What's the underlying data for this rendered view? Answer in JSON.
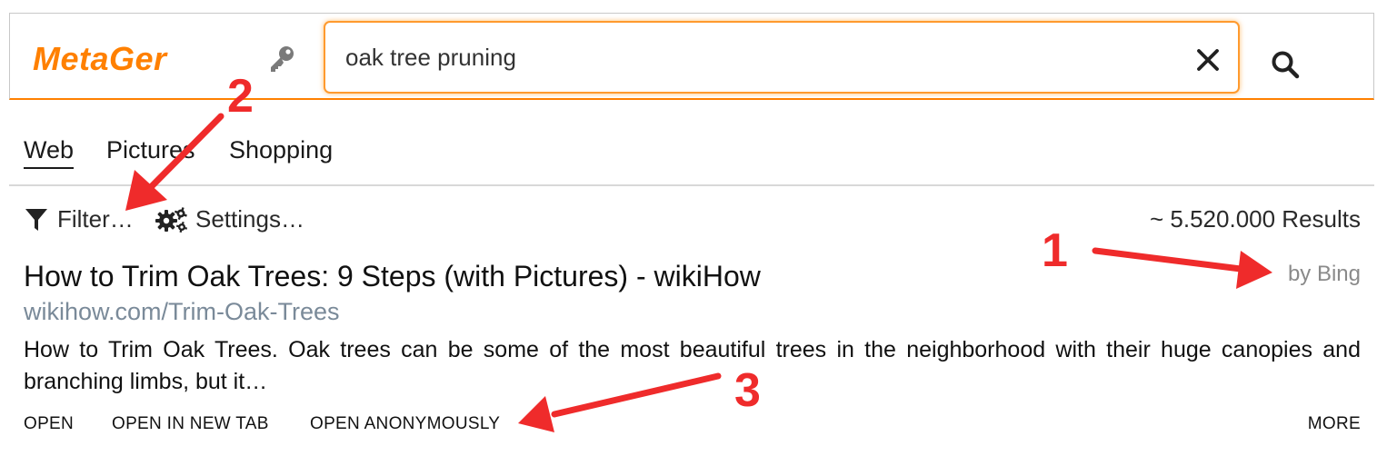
{
  "header": {
    "logo": "MetaGer",
    "search": {
      "value": "oak tree pruning",
      "placeholder": ""
    },
    "icons": {
      "key": "key-icon",
      "clear": "close-icon",
      "search": "search-icon"
    }
  },
  "tabs": [
    {
      "label": "Web",
      "active": true
    },
    {
      "label": "Pictures",
      "active": false
    },
    {
      "label": "Shopping",
      "active": false
    }
  ],
  "toolbar": {
    "filter_label": "Filter…",
    "settings_label": "Settings…",
    "results_count": "~ 5.520.000 Results"
  },
  "result": {
    "title": "How to Trim Oak Trees: 9 Steps (with Pictures) - wikiHow",
    "url": "wikihow.com/Trim-Oak-Trees",
    "description": "How to Trim Oak Trees. Oak trees can be some of the most beautiful trees in the neighborhood with their huge canopies and branching limbs, but it…",
    "engine": "by Bing",
    "actions": {
      "open": "OPEN",
      "open_new_tab": "OPEN IN NEW TAB",
      "open_anonymously": "OPEN ANONYMOUSLY",
      "more": "MORE"
    }
  },
  "annotations": {
    "one": "1",
    "two": "2",
    "three": "3"
  },
  "colors": {
    "brand": "#ff8000",
    "annotation": "#ef2b2b",
    "url": "#7a8a99"
  }
}
